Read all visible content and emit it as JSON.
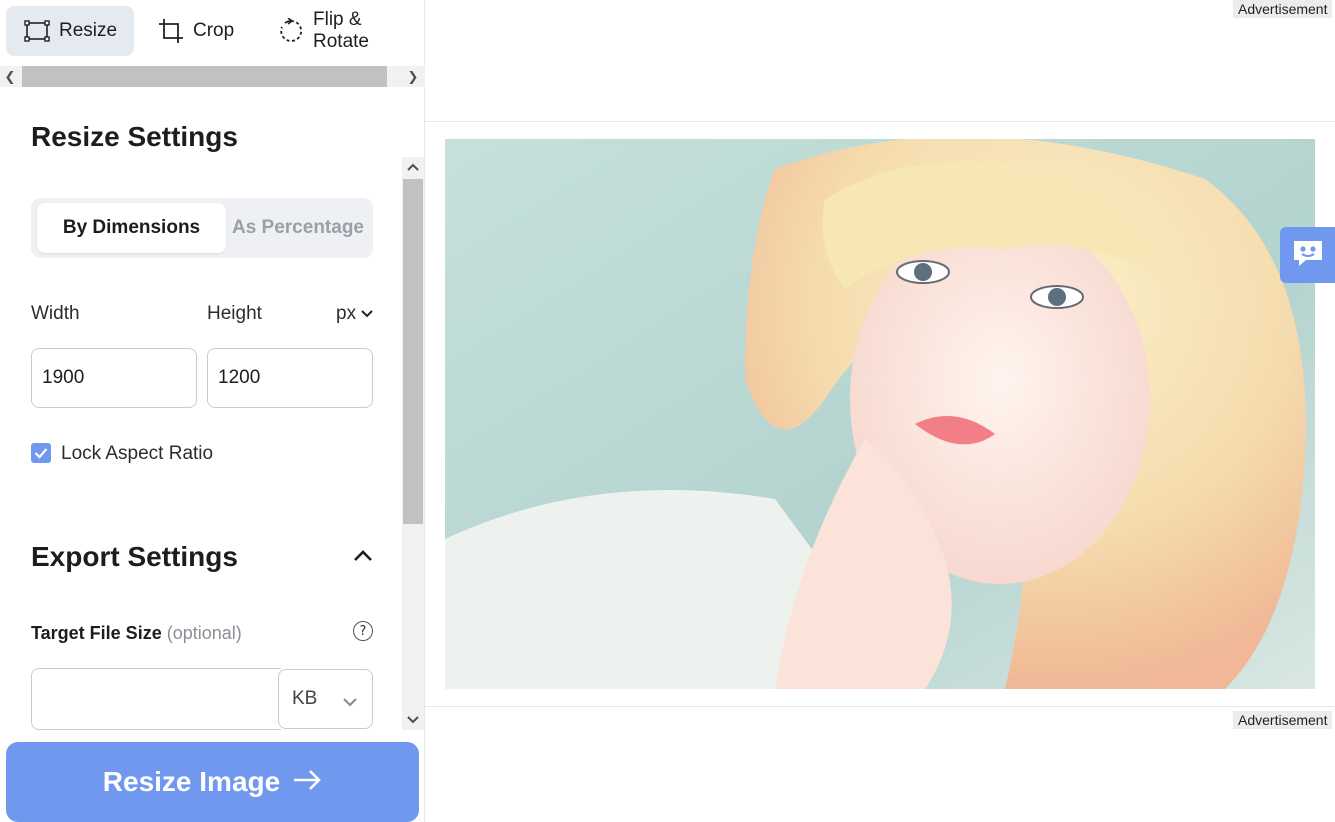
{
  "toolbar": {
    "tabs": [
      {
        "label": "Resize",
        "icon": "resize-icon",
        "active": true
      },
      {
        "label": "Crop",
        "icon": "crop-icon",
        "active": false
      },
      {
        "label": "Flip & Rotate",
        "icon": "rotate-icon",
        "active": false
      }
    ]
  },
  "resize_settings": {
    "title": "Resize Settings",
    "mode_tabs": [
      {
        "label": "By Dimensions",
        "selected": true
      },
      {
        "label": "As Percentage",
        "selected": false
      }
    ],
    "width_label": "Width",
    "height_label": "Height",
    "unit": "px",
    "width_value": "1900",
    "height_value": "1200",
    "lock_aspect_label": "Lock Aspect Ratio",
    "lock_aspect_checked": true
  },
  "export_settings": {
    "title": "Export Settings",
    "target_size_label": "Target File Size",
    "target_size_hint": "(optional)",
    "target_size_value": "",
    "size_unit": "KB",
    "help_icon": "question-circle-icon"
  },
  "cta": {
    "label": "Resize Image",
    "icon": "arrow-right-icon"
  },
  "ads": {
    "top_label": "Advertisement",
    "bottom_label": "Advertisement"
  },
  "chat_widget": {
    "icon": "chat-bot-icon"
  },
  "colors": {
    "accent": "#6f98ee",
    "active_tab_bg": "#e5e9f0",
    "muted_text": "#9aa0a8"
  }
}
